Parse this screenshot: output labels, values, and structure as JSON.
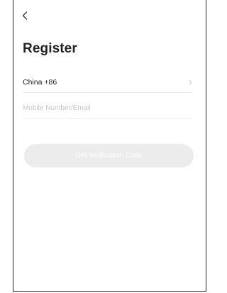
{
  "header": {
    "back_icon": "chevron-left-icon"
  },
  "page": {
    "title": "Register"
  },
  "region": {
    "label": "China +86",
    "icon": "chevron-right-icon"
  },
  "account": {
    "value": "",
    "placeholder": "Mobile Number/Email"
  },
  "actions": {
    "verify_label": "Get Verification Code",
    "verify_enabled": false
  },
  "colors": {
    "text_primary": "#222222",
    "placeholder": "#c6c6c6",
    "divider": "#ececec",
    "button_disabled_bg": "#ececec",
    "button_text": "#ffffff",
    "frame_border": "#2a2a2a"
  }
}
